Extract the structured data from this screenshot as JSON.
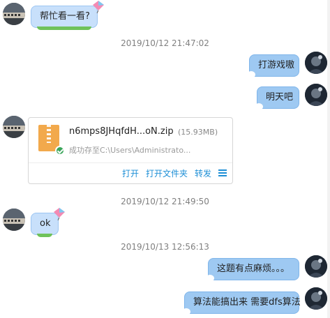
{
  "messages": {
    "m1": "帮忙看一看?",
    "m2": "打游戏嗷",
    "m3": "明天吧",
    "m4": "ok",
    "m5": "这题有点麻烦。。。",
    "m6": "算法能搞出来 需要dfs算法"
  },
  "timestamps": {
    "t1": "2019/10/12 21:47:02",
    "t2": "2019/10/12 21:49:50",
    "t3": "2019/10/13 12:56:13"
  },
  "file": {
    "name": "n6mps8JHqfdH...oN.zip",
    "size": "(15.93MB)",
    "status": "成功存至C:\\Users\\Administrato...",
    "actions": {
      "open": "打开",
      "open_folder": "打开文件夹",
      "forward": "转发"
    }
  },
  "colors": {
    "left_bubble": "#c8e0fb",
    "right_bubble": "#9ec9f2",
    "link": "#1e8fd6"
  }
}
